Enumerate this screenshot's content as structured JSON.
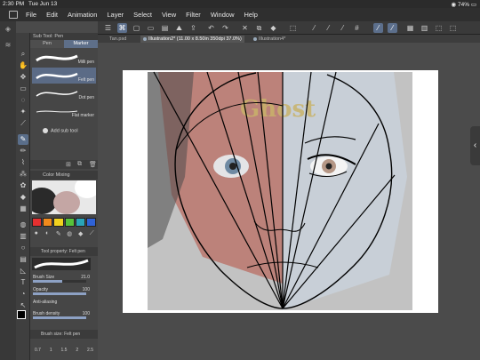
{
  "status": {
    "time": "2:30 PM",
    "date": "Tue Jun 13",
    "battery": "74%"
  },
  "menu": [
    "File",
    "Edit",
    "Animation",
    "Layer",
    "Select",
    "View",
    "Filter",
    "Window",
    "Help"
  ],
  "tabs": [
    "Tan.psd",
    "Illustration2* (11.00 x 8.50in 350dpi 37.0%)",
    "Illustration4*"
  ],
  "sub_tool": {
    "header": "Sub Tool: Pen",
    "tab_pen": "Pen",
    "tab_marker": "Marker",
    "brushes": [
      {
        "label": "Milli pen"
      },
      {
        "label": "Felt pen",
        "selected": true
      },
      {
        "label": "Dot pen"
      },
      {
        "label": "Flat marker"
      }
    ],
    "add_label": "Add sub tool"
  },
  "color": {
    "header": "Color Mixing",
    "swatches": [
      "#e53030",
      "#f08a1c",
      "#f2d21e",
      "#57c23a",
      "#2aa5b8",
      "#2f62d6",
      "#222222",
      "#f5f5f5"
    ]
  },
  "tool_property": {
    "header": "Tool property: Felt pen",
    "brush_size_label": "Brush Size",
    "brush_size_value": "21.0",
    "brush_size_fill": 0.55,
    "opacity_label": "Opacity",
    "opacity_value": "100",
    "antialias_label": "Anti-aliasing",
    "density_label": "Brush density",
    "density_value": "100"
  },
  "brush_size_panel": {
    "header": "Brush size: Felt pen",
    "values": [
      "0.7",
      "1",
      "1.5",
      "2",
      "2.5"
    ]
  },
  "canvas": {
    "watermark": "Ghost"
  }
}
